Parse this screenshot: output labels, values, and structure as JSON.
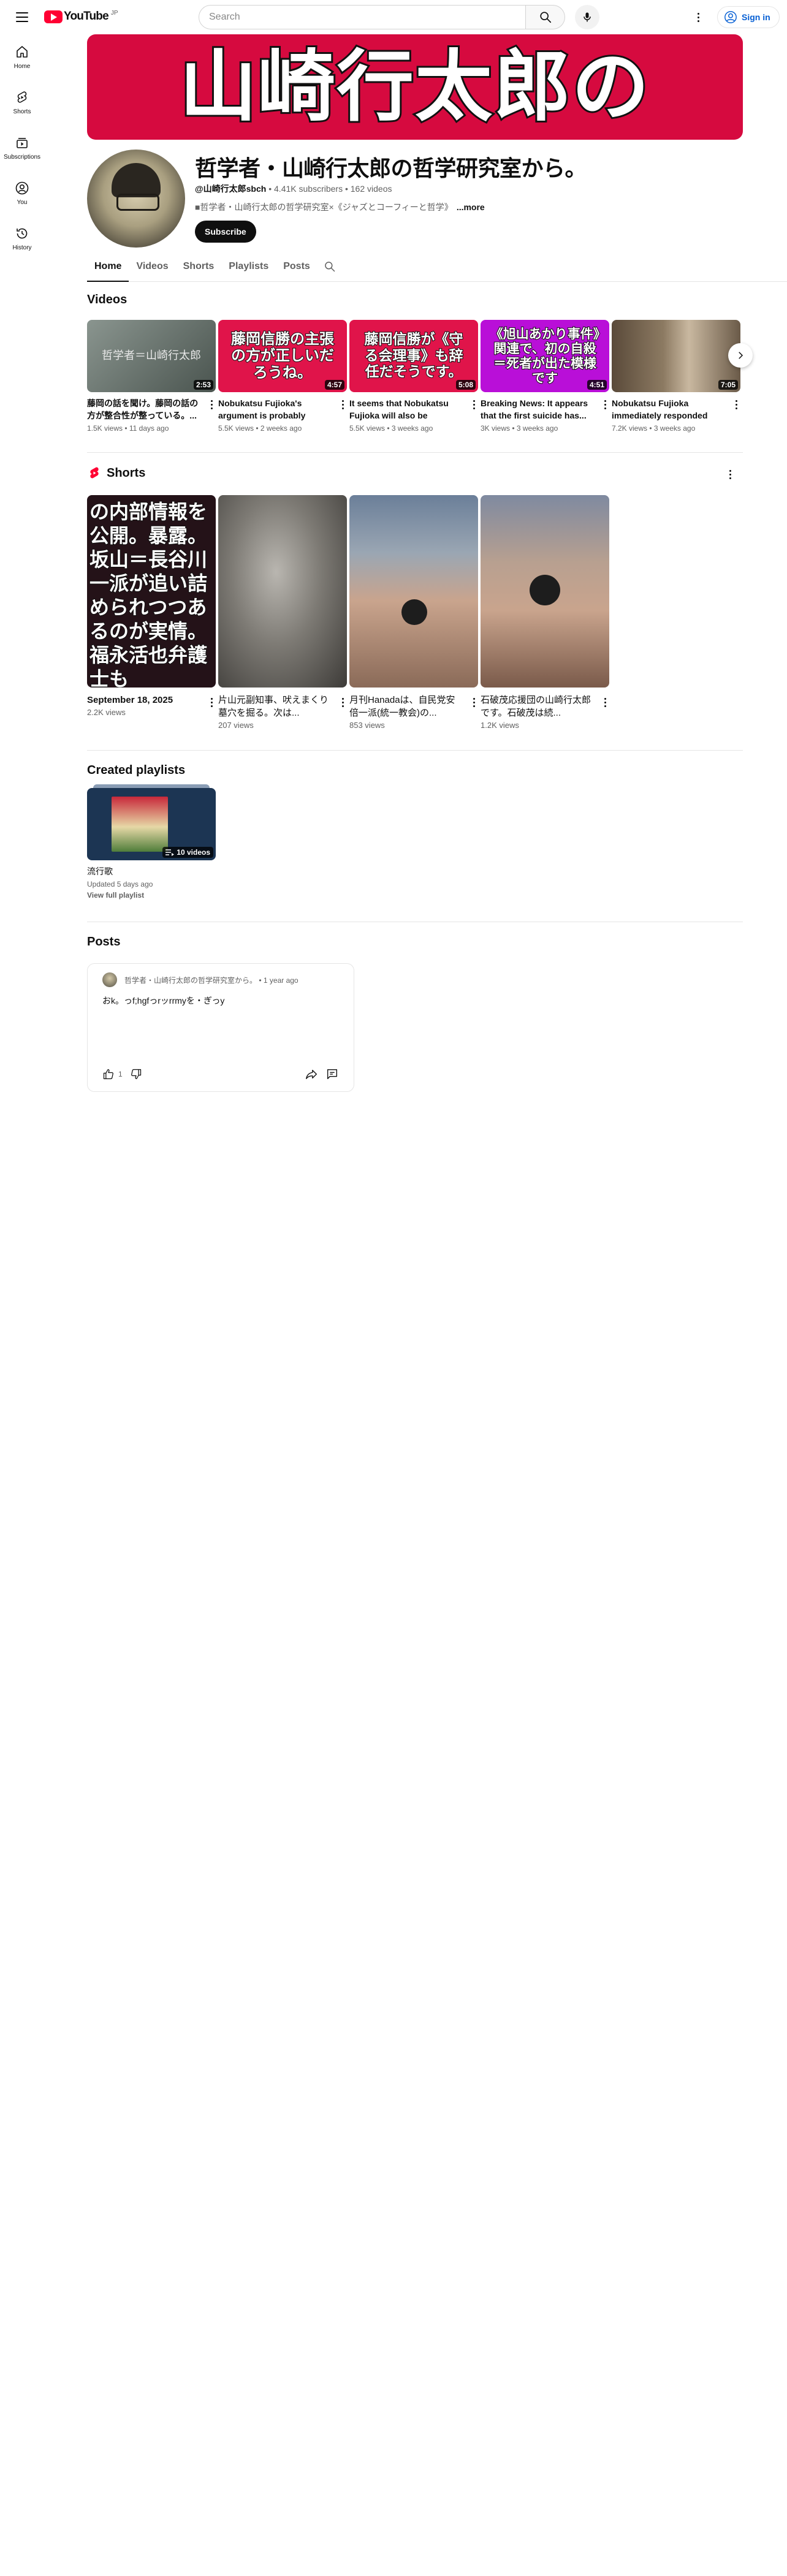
{
  "header": {
    "menu_icon": "hamburger-menu-icon",
    "logo_text": "YouTube",
    "logo_country": "JP",
    "search_placeholder": "Search",
    "search_icon": "search-icon",
    "mic_icon": "microphone-icon",
    "more_icon": "more-vertical-icon",
    "signin_label": "Sign in",
    "signin_icon": "account-circle-icon"
  },
  "sidebar": {
    "items": [
      {
        "label": "Home",
        "icon": "home-icon"
      },
      {
        "label": "Shorts",
        "icon": "shorts-icon"
      },
      {
        "label": "Subscriptions",
        "icon": "subscriptions-icon"
      },
      {
        "label": "You",
        "icon": "you-icon"
      },
      {
        "label": "History",
        "icon": "history-icon"
      }
    ]
  },
  "banner": {
    "text": "山崎行太郎の",
    "bg_color": "#d60a3f"
  },
  "channel": {
    "title": "哲学者・山崎行太郎の哲学研究室から。",
    "handle": "@山崎行太郎sbch",
    "subscribers": "4.41K subscribers",
    "videos_count": "162 videos",
    "separator": " • ",
    "description": "■哲学者・山崎行太郎の哲学研究室×《ジャズとコーフィーと哲学》",
    "more_label": "...more",
    "subscribe_label": "Subscribe"
  },
  "tabs": [
    {
      "label": "Home",
      "active": true
    },
    {
      "label": "Videos",
      "active": false
    },
    {
      "label": "Shorts",
      "active": false
    },
    {
      "label": "Playlists",
      "active": false
    },
    {
      "label": "Posts",
      "active": false
    }
  ],
  "videos_section": {
    "title": "Videos",
    "items": [
      {
        "thumb_text": "哲学者＝山崎行太郎",
        "duration": "2:53",
        "title": "藤岡の話を聞け。藤岡の話の方が整合性が整っている。...",
        "meta": "1.5K views • 11 days ago",
        "bg": "#6f7a74"
      },
      {
        "thumb_text": "藤岡信勝の主張の方が正しいだろうね。",
        "duration": "4:57",
        "title": "Nobukatsu Fujioka's argument is probably correc...",
        "meta": "5.5K views • 2 weeks ago",
        "bg": "#e0144a"
      },
      {
        "thumb_text": "藤岡信勝が《守る会理事》も辞任だそうです。",
        "duration": "5:08",
        "title": "It seems that Nobukatsu Fujioka will also be resignin...",
        "meta": "5.5K views • 3 weeks ago",
        "bg": "#e0144a"
      },
      {
        "thumb_text": "《旭山あかり事件》関連で、初の自殺＝死者が出た模様です",
        "duration": "4:51",
        "title": "Breaking News: It appears that the first suicide has...",
        "meta": "3K views • 3 weeks ago",
        "bg": "#b90fd8"
      },
      {
        "thumb_text": "",
        "duration": "7:05",
        "title": "Nobukatsu Fujioka immediately responded to...",
        "meta": "7.2K views • 3 weeks ago",
        "bg": "#8c7a62"
      }
    ],
    "next_icon": "chevron-right-icon"
  },
  "shorts_section": {
    "title": "Shorts",
    "shorts_icon": "shorts-logo-icon",
    "more_icon": "more-vertical-icon",
    "items": [
      {
        "thumb_text": "の内部情報を公開。暴露。坂山＝長谷川一派が追い詰められつつあるのが実情。福永活也弁護士も",
        "title": "September 18, 2025",
        "views": "2.2K views",
        "bg": "#241218"
      },
      {
        "thumb_text": "",
        "title": "片山元副知事、吠えまくり墓穴を掘る。次は...",
        "views": "207 views",
        "bg": "#6d6a65"
      },
      {
        "thumb_text": "",
        "title": "月刊Hanadaは、自民党安倍一派(統一教会)の...",
        "views": "853 views",
        "bg": "#a08070"
      },
      {
        "thumb_text": "",
        "title": "石破茂応援団の山崎行太郎です。石破茂は続...",
        "views": "1.2K views",
        "bg": "#9a7a6a"
      }
    ]
  },
  "playlists_section": {
    "title": "Created playlists",
    "items": [
      {
        "title": "流行歌",
        "updated": "Updated 5 days ago",
        "view_label": "View full playlist",
        "count": "10 videos",
        "playlist_icon": "playlist-icon"
      }
    ]
  },
  "posts_section": {
    "title": "Posts",
    "items": [
      {
        "author": "哲学者・山崎行太郎の哲学研究室から。",
        "time": "1 year ago",
        "separator": " • ",
        "body": "おk。っf;hgfっrッrrmyを・ぎっy",
        "likes": "1",
        "like_icon": "thumbs-up-icon",
        "dislike_icon": "thumbs-down-icon",
        "share_icon": "share-icon",
        "comment_icon": "comment-icon"
      }
    ]
  }
}
